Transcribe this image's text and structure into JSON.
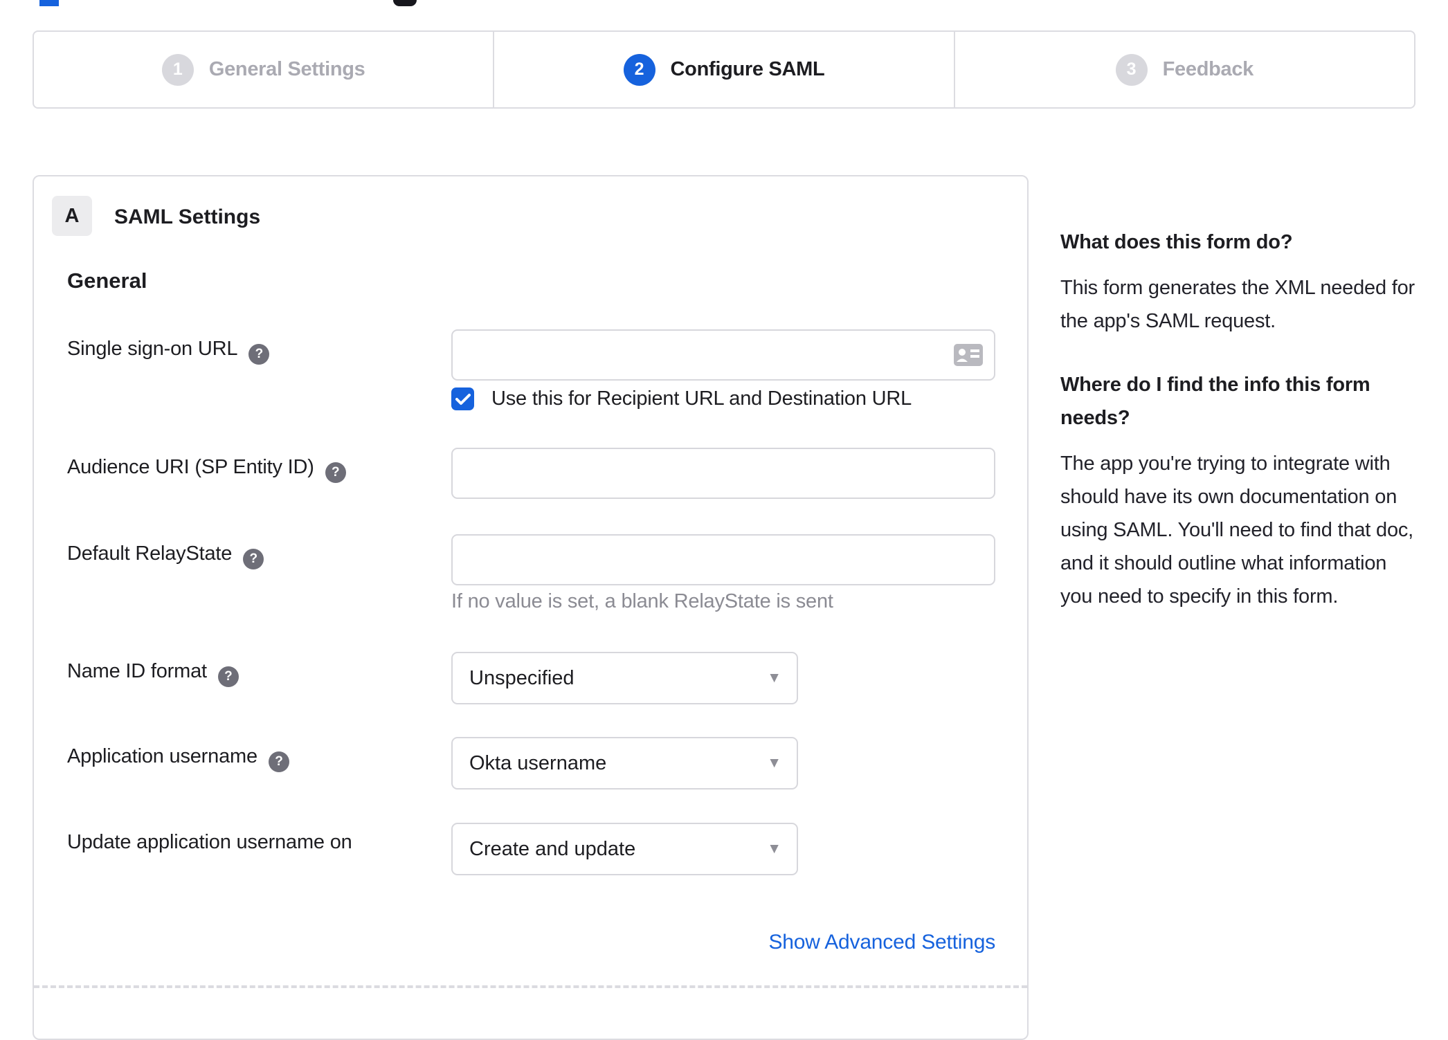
{
  "stepper": {
    "steps": [
      {
        "number": "1",
        "label": "General Settings",
        "state": "inactive"
      },
      {
        "number": "2",
        "label": "Configure SAML",
        "state": "active"
      },
      {
        "number": "3",
        "label": "Feedback",
        "state": "inactive"
      }
    ]
  },
  "panel": {
    "badge": "A",
    "title": "SAML Settings",
    "section_title": "General",
    "fields": {
      "sso_url": {
        "label": "Single sign-on URL",
        "value": ""
      },
      "sso_checkbox": {
        "label": "Use this for Recipient URL and Destination URL",
        "checked": true
      },
      "audience_uri": {
        "label": "Audience URI (SP Entity ID)",
        "value": ""
      },
      "relay_state": {
        "label": "Default RelayState",
        "value": "",
        "hint": "If no value is set, a blank RelayState is sent"
      },
      "name_id_format": {
        "label": "Name ID format",
        "value": "Unspecified"
      },
      "app_username": {
        "label": "Application username",
        "value": "Okta username"
      },
      "update_username": {
        "label": "Update application username on",
        "value": "Create and update"
      }
    },
    "advanced_link": "Show Advanced Settings"
  },
  "sidebar": {
    "question1": "What does this form do?",
    "answer1": "This form generates the XML needed for the app's SAML request.",
    "question2": "Where do I find the info this form needs?",
    "answer2": "The app you're trying to integrate with should have its own documentation on using SAML. You'll need to find that doc, and it should outline what information you need to specify in this form."
  },
  "icons": {
    "help": "?",
    "dropdown_caret": "▼"
  },
  "colors": {
    "accent_blue": "#1662dd",
    "inactive_gray": "#d8d8dd",
    "border_gray": "#d7d7dc",
    "hint_gray": "#8b8b93"
  }
}
